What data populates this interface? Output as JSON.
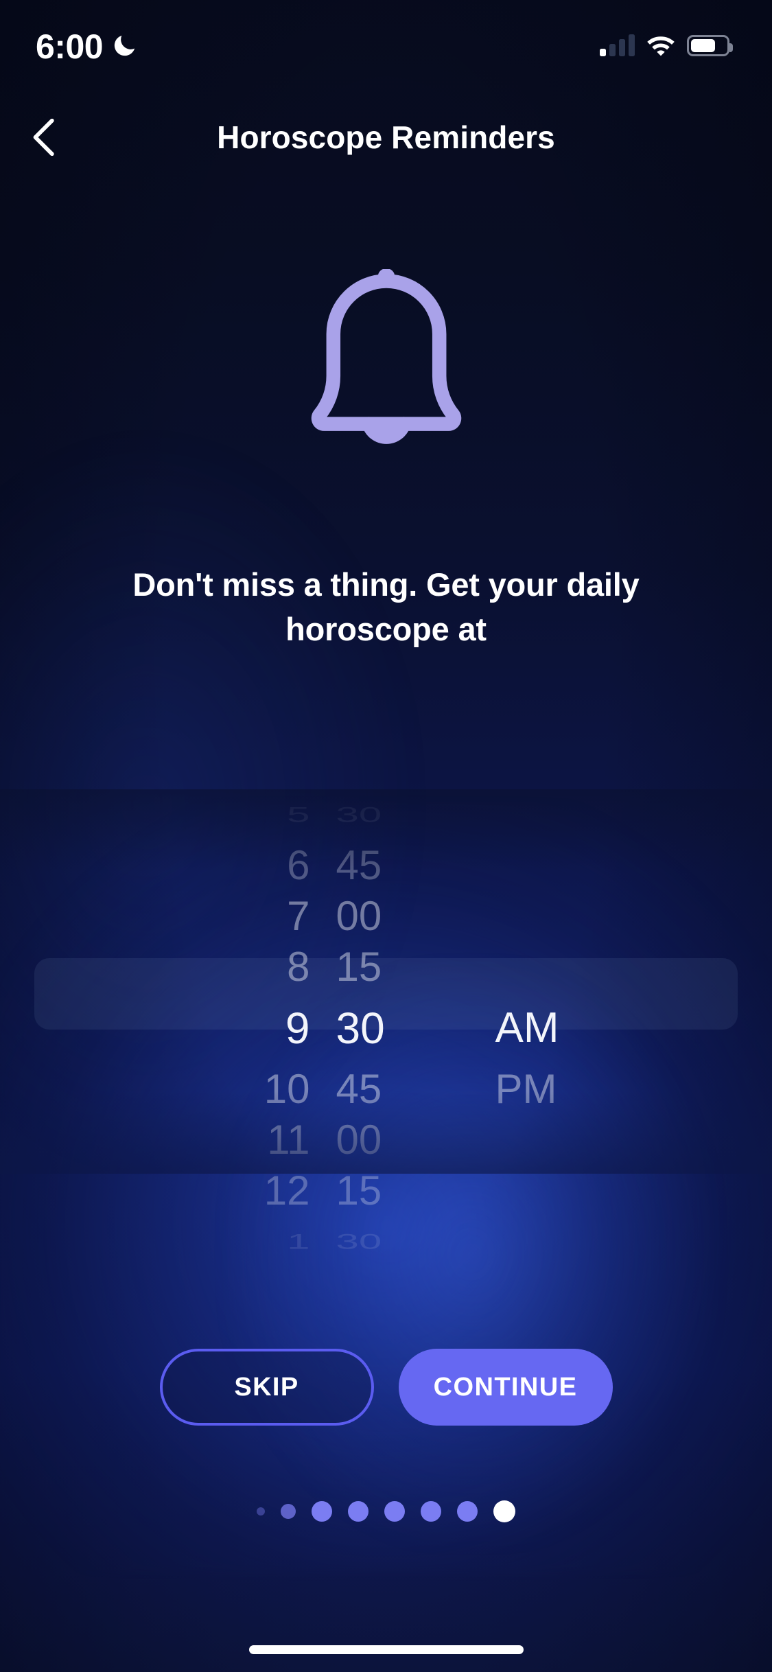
{
  "status_bar": {
    "time": "6:00",
    "dnd_icon": "moon-icon",
    "signal_icon": "cellular-signal-icon",
    "wifi_icon": "wifi-icon",
    "battery_icon": "battery-icon",
    "battery_level_percent": 62
  },
  "header": {
    "back_icon": "chevron-left-icon",
    "title": "Horoscope Reminders"
  },
  "hero": {
    "icon": "bell-icon",
    "icon_color": "#A9A2E9",
    "headline": "Don't miss a thing. Get your daily horoscope at"
  },
  "time_picker": {
    "selected_hour": "9",
    "selected_minute": "30",
    "selected_meridiem": "AM",
    "hours_above": [
      "5",
      "6",
      "7",
      "8"
    ],
    "hours_below": [
      "10",
      "11",
      "12",
      "1"
    ],
    "minutes_above": [
      "30",
      "45",
      "00",
      "15"
    ],
    "minutes_below": [
      "45",
      "00",
      "15",
      "30"
    ],
    "meridiem_below": [
      "PM"
    ],
    "highlight_color": "#96ACDC"
  },
  "actions": {
    "skip_label": "SKIP",
    "continue_label": "CONTINUE",
    "skip_border_color": "#5B5CF0",
    "continue_bg_color": "#6668F2"
  },
  "pagination": {
    "total": 8,
    "active_index": 7,
    "active_color": "#FFFFFF",
    "inactive_color": "#7B7DF2",
    "dots": [
      {
        "size": 12,
        "active": false
      },
      {
        "size": 22,
        "active": false
      },
      {
        "size": 30,
        "active": false
      },
      {
        "size": 30,
        "active": false
      },
      {
        "size": 30,
        "active": false
      },
      {
        "size": 30,
        "active": false
      },
      {
        "size": 30,
        "active": false
      },
      {
        "size": 32,
        "active": true
      }
    ]
  },
  "home_indicator": {
    "present": true
  }
}
